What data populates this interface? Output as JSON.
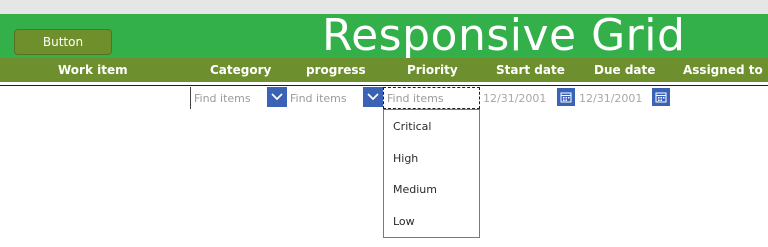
{
  "app": {
    "title": "Responsive Grid",
    "button_label": "Button"
  },
  "columns": [
    {
      "label": "Work item"
    },
    {
      "label": "Category"
    },
    {
      "label": "progress"
    },
    {
      "label": "Priority"
    },
    {
      "label": "Start date"
    },
    {
      "label": "Due date"
    },
    {
      "label": "Assigned to"
    }
  ],
  "filters": {
    "category_placeholder": "Find items",
    "progress_placeholder": "Find items",
    "priority_placeholder": "Find items",
    "start_date": "12/31/2001",
    "due_date": "12/31/2001"
  },
  "priority_options": [
    "Critical",
    "High",
    "Medium",
    "Low"
  ],
  "colors": {
    "top_green": "#34b04a",
    "header_green": "#6e8f2d",
    "control_blue": "#3b63b5"
  },
  "icons": {
    "dropdown": "chevron-down-icon",
    "date": "calendar-icon"
  }
}
